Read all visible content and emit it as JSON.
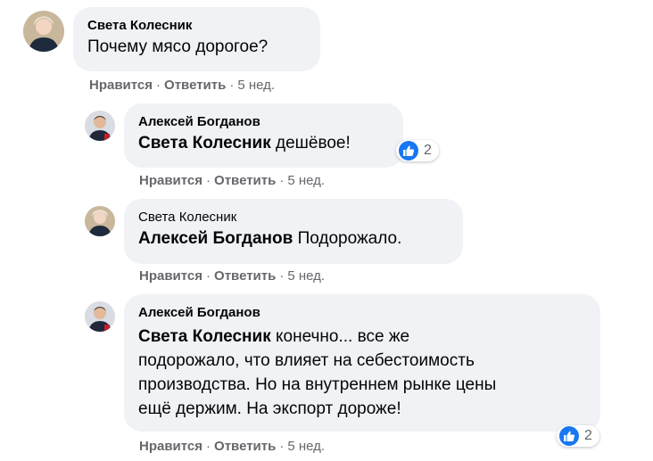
{
  "comments": [
    {
      "author": "Света Колесник",
      "mention": "",
      "text": "Почему мясо дорогое?",
      "actions": {
        "like": "Нравится",
        "reply": "Ответить",
        "time": "5 нед."
      }
    },
    {
      "author": "Алексей Богданов",
      "mention": "Света Колесник",
      "text": "дешёвое!",
      "reactions": "2",
      "actions": {
        "like": "Нравится",
        "reply": "Ответить",
        "time": "5 нед."
      }
    },
    {
      "author": "Света Колесник",
      "mention": "Алексей Богданов",
      "text": "Подорожало.",
      "actions": {
        "like": "Нравится",
        "reply": "Ответить",
        "time": "5 нед."
      }
    },
    {
      "author": "Алексей Богданов",
      "mention": "Света Колесник",
      "text_lines": [
        "конечно... все же",
        "подорожало, что влияет на себестоимость",
        "производства. Но на внутреннем рынке цены",
        "ещё держим. На экспорт дороже!"
      ],
      "reactions": "2",
      "actions": {
        "like": "Нравится",
        "reply": "Ответить",
        "time": "5 нед."
      }
    }
  ],
  "icons": {
    "like": "like-icon"
  },
  "colors": {
    "bubble": "#f0f2f5",
    "like_blue": "#1877f2",
    "meta_gray": "#65676b"
  }
}
